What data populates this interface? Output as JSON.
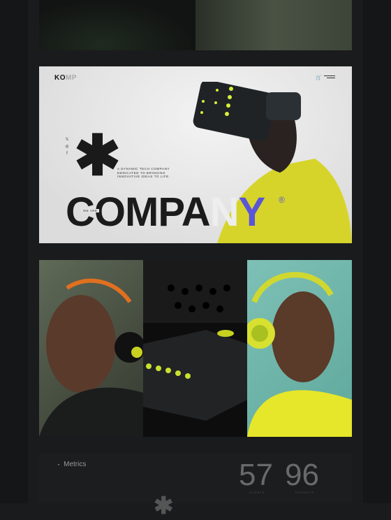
{
  "hero": {
    "logo_dark": "KO",
    "logo_light": "MP",
    "cart_icon": "cart-icon",
    "menu_icon": "menu-icon",
    "social": [
      "x-icon",
      "instagram-icon",
      "facebook-icon"
    ],
    "social_glyphs": [
      "𝕏",
      "◎",
      "f"
    ],
    "asterisk": "✱",
    "tagline": "A DYNAMIC TECH COMPANY DEDICATED TO BRINGING INNOVATIVE IDEAS TO LIFE.",
    "we_are": "WE ARE",
    "headline_dark": "COMPA",
    "headline_light": "N",
    "headline_accent": "Y",
    "registered": "®",
    "accent_color": "#5a55d8"
  },
  "metrics": {
    "label": "Metrics",
    "bullet": "•",
    "stats": [
      {
        "value": "57",
        "label": "CLIENTS"
      },
      {
        "value": "96",
        "label": "PROJECTS"
      }
    ]
  }
}
